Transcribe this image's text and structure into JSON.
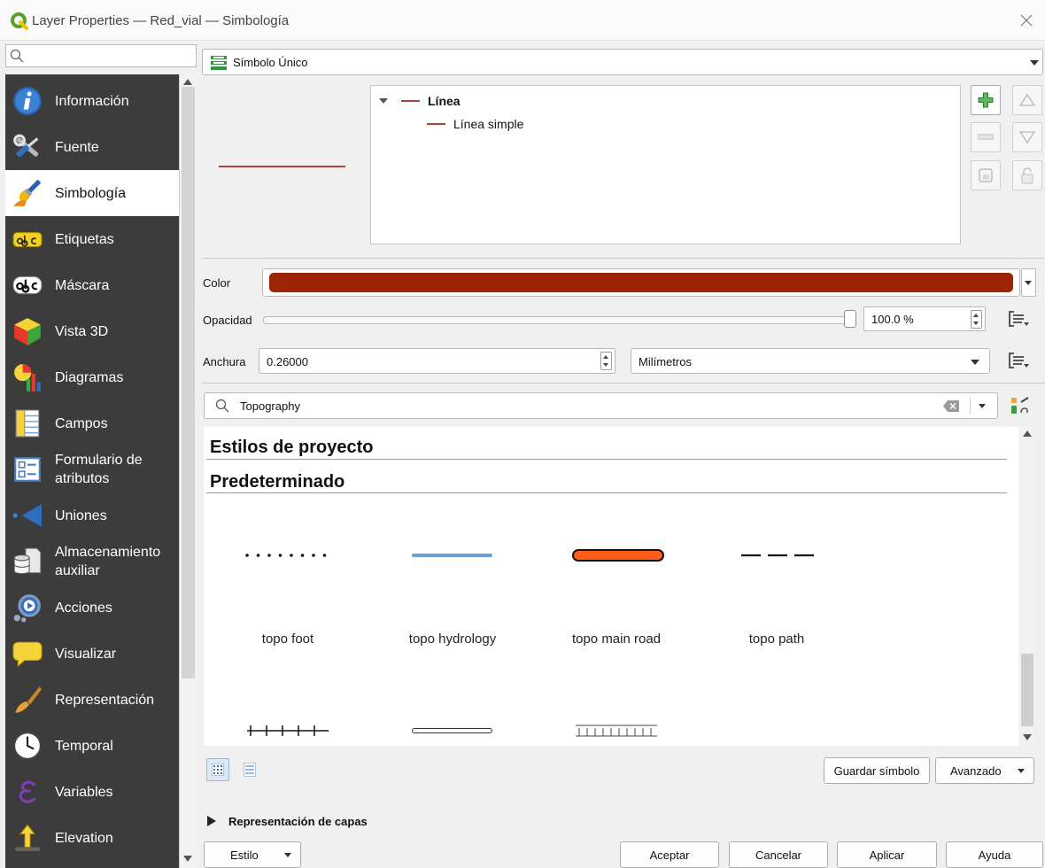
{
  "window": {
    "title": "Layer Properties — Red_vial — Simbología",
    "close_icon": "close-icon"
  },
  "sidebar": {
    "items": [
      {
        "label": "Información",
        "icon": "info-icon"
      },
      {
        "label": "Fuente",
        "icon": "source-icon"
      },
      {
        "label": "Simbología",
        "icon": "symbology-icon",
        "selected": true
      },
      {
        "label": "Etiquetas",
        "icon": "labels-icon"
      },
      {
        "label": "Máscara",
        "icon": "mask-icon"
      },
      {
        "label": "Vista 3D",
        "icon": "3d-view-icon"
      },
      {
        "label": "Diagramas",
        "icon": "diagrams-icon"
      },
      {
        "label": "Campos",
        "icon": "fields-icon"
      },
      {
        "label": "Formulario de atributos",
        "icon": "attributes-form-icon"
      },
      {
        "label": "Uniones",
        "icon": "joins-icon"
      },
      {
        "label": "Almacenamiento auxiliar",
        "icon": "auxiliary-storage-icon"
      },
      {
        "label": "Acciones",
        "icon": "actions-icon"
      },
      {
        "label": "Visualizar",
        "icon": "display-icon"
      },
      {
        "label": "Representación",
        "icon": "rendering-icon"
      },
      {
        "label": "Temporal",
        "icon": "temporal-icon"
      },
      {
        "label": "Variables",
        "icon": "variables-icon"
      },
      {
        "label": "Elevation",
        "icon": "elevation-icon"
      }
    ]
  },
  "renderer": {
    "label": "Símbolo Único",
    "icon": "single-symbol-icon"
  },
  "symbol_tree": {
    "root": "Línea",
    "layers": [
      "Línea simple"
    ]
  },
  "colors": {
    "symbol_color": "#9c2505",
    "sidebar_bg": "#3c3c3c"
  },
  "properties": {
    "color_label": "Color",
    "opacity_label": "Opacidad",
    "opacity_value": "100.0 %",
    "opacity_fraction": 1.0,
    "width_label": "Anchura",
    "width_value": "0.26000",
    "width_unit": "Milímetros"
  },
  "library": {
    "search_value": "Topography",
    "groups": [
      "Estilos de proyecto",
      "Predeterminado"
    ],
    "symbols": [
      {
        "name": "topo foot"
      },
      {
        "name": "topo hydrology"
      },
      {
        "name": "topo main road"
      },
      {
        "name": "topo path"
      }
    ]
  },
  "actions": {
    "save_symbol": "Guardar símbolo",
    "advanced": "Avanzado"
  },
  "layer_rendering": {
    "label": "Representación de capas",
    "expanded": false
  },
  "footer": {
    "style": "Estilo",
    "ok": "Aceptar",
    "cancel": "Cancelar",
    "apply": "Aplicar",
    "help": "Ayuda"
  }
}
